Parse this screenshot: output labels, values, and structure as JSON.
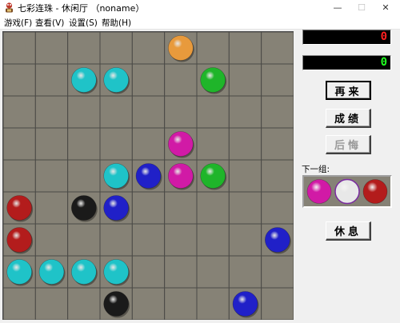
{
  "window": {
    "title": "七彩连珠 - 休闲厅 （noname）",
    "min_glyph": "—",
    "max_glyph": "☐",
    "close_glyph": "✕"
  },
  "menu": {
    "items": [
      "游戏(F)",
      "查看(V)",
      "设置(S)",
      "帮助(H)"
    ]
  },
  "scores": {
    "current": "0",
    "high": "0"
  },
  "buttons": {
    "again": "再来",
    "records": "成绩",
    "undo": "后悔",
    "rest": "休息"
  },
  "next_label": "下一组:",
  "colors": {
    "board_bg": "#868276",
    "grid_line": "#4a4a46",
    "orange": "#e89a3c",
    "cyan": "#1fc3c8",
    "green": "#1fb52a",
    "magenta": "#d11aa6",
    "blue": "#2020c8",
    "red": "#b31c1c",
    "black": "#1a1a1a",
    "white": "#e8e8e8"
  },
  "board": {
    "cols": 9,
    "rows": 9,
    "balls": [
      {
        "row": 0,
        "col": 5,
        "color": "orange"
      },
      {
        "row": 1,
        "col": 2,
        "color": "cyan"
      },
      {
        "row": 1,
        "col": 3,
        "color": "cyan"
      },
      {
        "row": 1,
        "col": 6,
        "color": "green"
      },
      {
        "row": 3,
        "col": 5,
        "color": "magenta"
      },
      {
        "row": 4,
        "col": 3,
        "color": "cyan"
      },
      {
        "row": 4,
        "col": 4,
        "color": "blue"
      },
      {
        "row": 4,
        "col": 5,
        "color": "magenta"
      },
      {
        "row": 4,
        "col": 6,
        "color": "green"
      },
      {
        "row": 5,
        "col": 0,
        "color": "red"
      },
      {
        "row": 5,
        "col": 2,
        "color": "black"
      },
      {
        "row": 5,
        "col": 3,
        "color": "blue"
      },
      {
        "row": 6,
        "col": 0,
        "color": "red"
      },
      {
        "row": 6,
        "col": 8,
        "color": "blue"
      },
      {
        "row": 7,
        "col": 0,
        "color": "cyan"
      },
      {
        "row": 7,
        "col": 1,
        "color": "cyan"
      },
      {
        "row": 7,
        "col": 2,
        "color": "cyan"
      },
      {
        "row": 7,
        "col": 3,
        "color": "cyan"
      },
      {
        "row": 8,
        "col": 3,
        "color": "black"
      },
      {
        "row": 8,
        "col": 7,
        "color": "blue"
      }
    ]
  },
  "next_balls": [
    "magenta",
    "white",
    "red"
  ]
}
